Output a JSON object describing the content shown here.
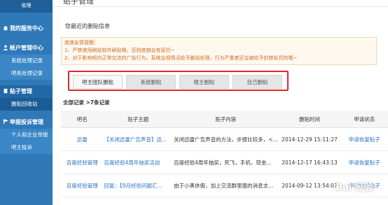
{
  "sidebar": {
    "top_label": "收理",
    "sections": [
      {
        "label": "我的服务中心",
        "icon": "house-icon",
        "items": []
      },
      {
        "label": "帐户管理中心",
        "icon": "person-icon",
        "items": [
          "系统处理记录",
          "吧务处理记录"
        ]
      },
      {
        "label": "贴子管理",
        "icon": "document-icon",
        "items": [
          "删贴回收站"
        ]
      },
      {
        "label": "举报投诉管理",
        "icon": "flag-icon",
        "items": [
          "个人和企业举报",
          "吧主投诉"
        ]
      }
    ]
  },
  "main": {
    "page_title": "贴子管理",
    "section_title": "您最近的删贴信息",
    "notice": {
      "line1": "度娘友情提醒：",
      "line2": "1、严禁使用刷贴软件刷贴哦，否则度娘会有惩罚~",
      "line3": "2、对于影响吧内正常交流的广告行为，系统会视情况给予删贴处理，行为严重者还会被给予封禁处罚的哦~"
    },
    "tabs": [
      "吧主团队删贴",
      "系统删贴",
      "楼主删贴",
      "自己删贴"
    ],
    "summary_prefix": "全部记录 >",
    "summary_count": "7条记录",
    "table": {
      "headers": [
        "吧名",
        "贴子主题",
        "贴子内容",
        "删贴时间",
        "申请状态"
      ],
      "rows": [
        {
          "bar": "迅雷",
          "topic": "【关闭迅雷广告声音】迅...",
          "content": "关闭迅雷广告声音的方法，步骤比较多，<...",
          "time": "2014-12-29 15:11:27",
          "status": "申请恢复贴子"
        },
        {
          "bar": "百度经验管理",
          "topic": "百度经验4周年抽奖活动",
          "content": "百度经验4周年抽奖，死飞，手机，现金...",
          "time": "2014-12-17 16:43:13",
          "status": "申请恢复贴子"
        },
        {
          "bar": "百度经验管理",
          "topic": "回复：【9月经验问题汇...",
          "content": "由于小黑休假，加上交流群里面的消息太...",
          "time": "2014-09-12 13:54:07",
          "status": "申请恢复贴子"
        }
      ]
    }
  },
  "watermark": "Bai 经验"
}
